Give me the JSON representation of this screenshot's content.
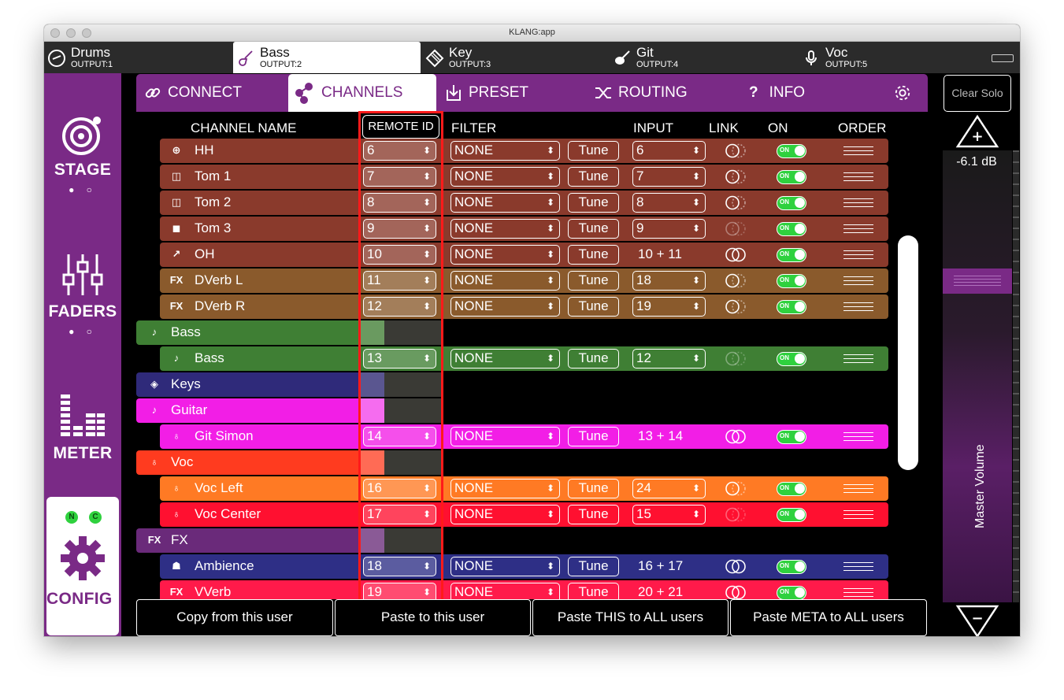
{
  "window": {
    "title": "KLANG:app"
  },
  "users": [
    {
      "name": "Drums",
      "output": "OUTPUT:1",
      "icon": "drum-icon"
    },
    {
      "name": "Bass",
      "output": "OUTPUT:2",
      "icon": "bass-guitar-icon",
      "active": true
    },
    {
      "name": "Key",
      "output": "OUTPUT:3",
      "icon": "keys-icon"
    },
    {
      "name": "Git",
      "output": "OUTPUT:4",
      "icon": "guitar-icon"
    },
    {
      "name": "Voc",
      "output": "OUTPUT:5",
      "icon": "microphone-icon"
    }
  ],
  "sidebar": {
    "stage": "STAGE",
    "faders": "FADERS",
    "meter": "METER",
    "config": "CONFIG",
    "dots": "● ○",
    "config_leds": [
      "N",
      "C"
    ]
  },
  "nav": [
    {
      "label": "CONNECT",
      "icon": "link-icon"
    },
    {
      "label": "CHANNELS",
      "icon": "channels-icon",
      "active": true
    },
    {
      "label": "PRESET",
      "icon": "download-icon"
    },
    {
      "label": "ROUTING",
      "icon": "routing-icon"
    },
    {
      "label": "INFO",
      "icon": "question-icon"
    }
  ],
  "columns": {
    "channel_name": "CHANNEL NAME",
    "remote_id": "REMOTE ID",
    "filter": "FILTER",
    "input": "INPUT",
    "link": "LINK",
    "on": "ON",
    "order": "ORDER"
  },
  "common": {
    "tune": "Tune",
    "on": "ON",
    "arrows": "⬍"
  },
  "colors": {
    "purple": "#7a2a86",
    "drums": "#8a3a2c",
    "fx_drums": "#8a5a2c",
    "bass": "#3f7f34",
    "keys": "#2f2a7a",
    "guitar": "#f21ee6",
    "voc_group": "#ff3b1f",
    "voc_left": "#ff7a24",
    "voc_center": "#ff1030",
    "fx_group": "#6a2a7a",
    "ambience": "#2e2f86",
    "vverb": "#ff1a4a",
    "highlight": "#ff1a1a",
    "toggle": "#2fd13e"
  },
  "rows": [
    {
      "type": "channel",
      "name": "HH",
      "icon": "hihat-icon",
      "remote_id": "6",
      "filter": "NONE",
      "input": "6",
      "input_select": true,
      "link": "half",
      "color": "#8a3a2c"
    },
    {
      "type": "channel",
      "name": "Tom 1",
      "icon": "tom-icon",
      "remote_id": "7",
      "filter": "NONE",
      "input": "7",
      "input_select": true,
      "link": "half",
      "color": "#8a3a2c"
    },
    {
      "type": "channel",
      "name": "Tom 2",
      "icon": "tom-icon",
      "remote_id": "8",
      "filter": "NONE",
      "input": "8",
      "input_select": true,
      "link": "half",
      "color": "#8a3a2c"
    },
    {
      "type": "channel",
      "name": "Tom 3",
      "icon": "tom-filled-icon",
      "remote_id": "9",
      "filter": "NONE",
      "input": "9",
      "input_select": true,
      "link": "dim",
      "color": "#8a3a2c"
    },
    {
      "type": "channel",
      "name": "OH",
      "icon": "overhead-mic-icon",
      "remote_id": "10",
      "filter": "NONE",
      "input": "10 + 11",
      "input_select": false,
      "link": "full",
      "color": "#8a3a2c"
    },
    {
      "type": "channel",
      "name": "DVerb L",
      "icon": "fx-icon",
      "remote_id": "11",
      "filter": "NONE",
      "input": "18",
      "input_select": true,
      "link": "half",
      "color": "#8a5a2c"
    },
    {
      "type": "channel",
      "name": "DVerb R",
      "icon": "fx-icon",
      "remote_id": "12",
      "filter": "NONE",
      "input": "19",
      "input_select": true,
      "link": "half",
      "color": "#8a5a2c"
    },
    {
      "type": "group",
      "name": "Bass",
      "icon": "bass-guitar-icon",
      "color": "#3f7f34",
      "ghost": "#6a9a60"
    },
    {
      "type": "channel",
      "name": "Bass",
      "icon": "bass-guitar-icon",
      "remote_id": "13",
      "filter": "NONE",
      "input": "12",
      "input_select": true,
      "link": "dim",
      "color": "#3f7f34"
    },
    {
      "type": "group",
      "name": "Keys",
      "icon": "keys-icon",
      "color": "#2f2a7a",
      "ghost": "#5a5690"
    },
    {
      "type": "group",
      "name": "Guitar",
      "icon": "guitar-icon",
      "color": "#f21ee6",
      "ghost": "#f56cef"
    },
    {
      "type": "channel",
      "name": "Git Simon",
      "icon": "microphone-icon",
      "remote_id": "14",
      "filter": "NONE",
      "input": "13 + 14",
      "input_select": false,
      "link": "full",
      "color": "#f21ee6"
    },
    {
      "type": "group",
      "name": "Voc",
      "icon": "microphone-icon",
      "color": "#ff3b1f",
      "ghost": "#ff6b55"
    },
    {
      "type": "channel",
      "name": "Voc Left",
      "icon": "microphone-icon",
      "remote_id": "16",
      "filter": "NONE",
      "input": "24",
      "input_select": true,
      "link": "half",
      "color": "#ff7a24"
    },
    {
      "type": "channel",
      "name": "Voc Center",
      "icon": "microphone-icon",
      "remote_id": "17",
      "filter": "NONE",
      "input": "15",
      "input_select": true,
      "link": "dim",
      "color": "#ff1030"
    },
    {
      "type": "group",
      "name": "FX",
      "icon": "fx-icon",
      "color": "#6a2a7a",
      "ghost": "#8a5a96"
    },
    {
      "type": "channel",
      "name": "Ambience",
      "icon": "audience-icon",
      "remote_id": "18",
      "filter": "NONE",
      "input": "16 + 17",
      "input_select": false,
      "link": "full",
      "color": "#2e2f86"
    },
    {
      "type": "channel",
      "name": "VVerb",
      "icon": "fx-icon",
      "remote_id": "19",
      "filter": "NONE",
      "input": "20 + 21",
      "input_select": false,
      "link": "full",
      "color": "#ff1a4a"
    }
  ],
  "bottom": {
    "copy": "Copy from this user",
    "paste": "Paste to this user",
    "paste_all": "Paste THIS to ALL users",
    "paste_meta": "Paste META to ALL users"
  },
  "master": {
    "clear_solo": "Clear Solo",
    "db": "-6.1 dB",
    "label": "Master Volume",
    "plus": "+",
    "minus": "−",
    "level_fraction": 0.62
  }
}
